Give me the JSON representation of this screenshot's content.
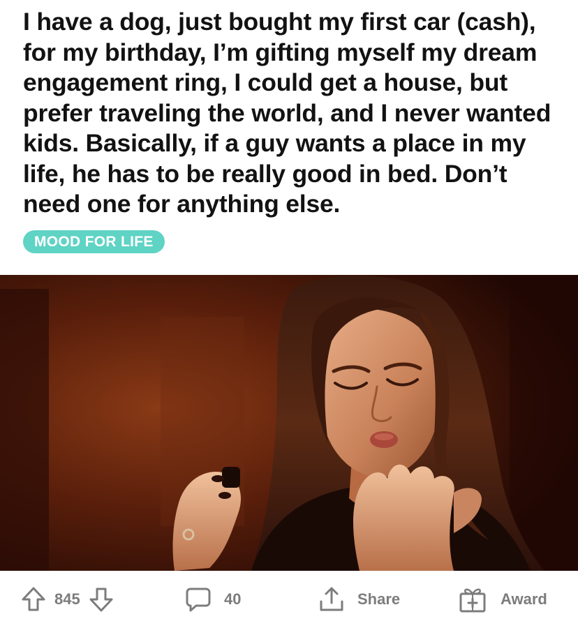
{
  "post": {
    "title": "I have a dog, just bought my first car (cash), for my birthday, I’m gifting myself my dream engagement ring, I could get a house, but prefer traveling the world, and I never wanted kids. Basically, if a guy wants a place in my life, he has to be really good in bed. Don’t need one for anything else.",
    "flair": "MOOD FOR LIFE",
    "flair_color": "#5fd3c4",
    "media": {
      "kind": "gif-still",
      "subject": "woman-blowing-on-fingernails"
    }
  },
  "actions": {
    "upvote_icon": "arrow-up-icon",
    "vote_count": "845",
    "downvote_icon": "arrow-down-icon",
    "comment_icon": "speech-bubble-icon",
    "comment_count": "40",
    "share_icon": "share-upload-icon",
    "share_label": "Share",
    "award_icon": "gift-box-icon",
    "award_label": "Award",
    "icon_color": "#7c7c7c"
  }
}
